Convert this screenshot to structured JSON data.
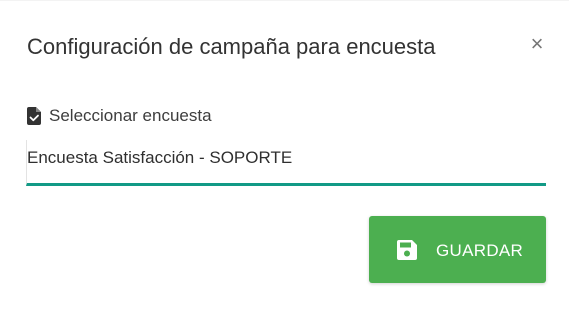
{
  "modal": {
    "title": "Configuración de campaña para encuesta",
    "close_glyph": "×"
  },
  "form": {
    "label": "Seleccionar encuesta",
    "label_icon": "file-check-icon",
    "selected_value": "Encuesta Satisfacción - SOPORTE"
  },
  "actions": {
    "save_label": "GUARDAR",
    "save_icon": "floppy-disk-icon"
  },
  "colors": {
    "accent_underline": "#129a86",
    "save_button": "#4caf50"
  }
}
